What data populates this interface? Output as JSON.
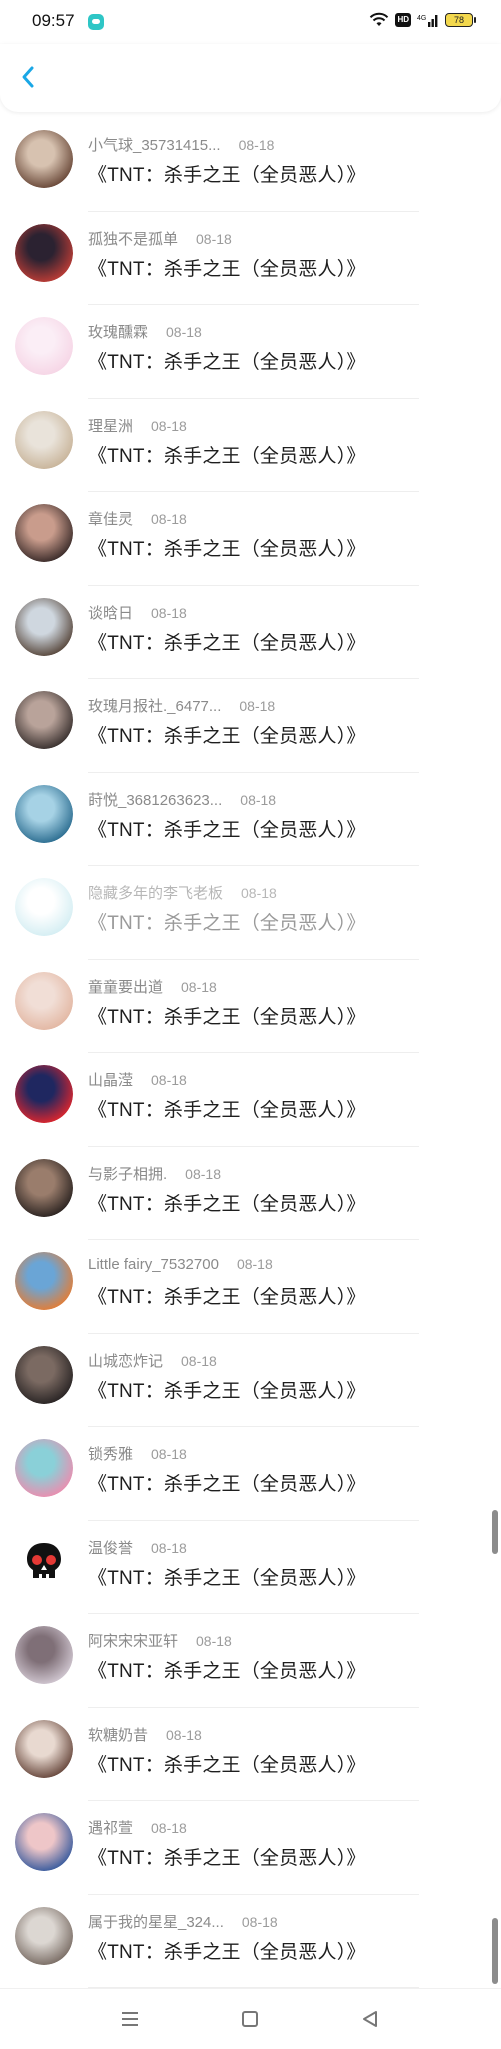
{
  "status_bar": {
    "time": "09:57",
    "app_icon": "message-bubble-icon",
    "hd_label": "HD",
    "signal_label": "4G",
    "battery": "78"
  },
  "header": {
    "back_icon": "chevron-left-icon",
    "accent": "#1aa7e6"
  },
  "message_text": "《TNT：杀手之王（全员恶人）》",
  "items": [
    {
      "name": "小气球_35731415...",
      "date": "08-18",
      "avatar_colors": [
        "#6b4a3a",
        "#d7c2b0"
      ]
    },
    {
      "name": "孤独不是孤单",
      "date": "08-18",
      "avatar_colors": [
        "#b93c36",
        "#2b2231"
      ]
    },
    {
      "name": "玫瑰醺霖",
      "date": "08-18",
      "avatar_colors": [
        "#f6d6e6",
        "#fbeef6"
      ]
    },
    {
      "name": "理星洲",
      "date": "08-18",
      "avatar_colors": [
        "#c9b59b",
        "#e9e3da"
      ]
    },
    {
      "name": "章佳灵",
      "date": "08-18",
      "avatar_colors": [
        "#3d2d2b",
        "#c99c8c"
      ]
    },
    {
      "name": "谈晗日",
      "date": "08-18",
      "avatar_colors": [
        "#5a4a3f",
        "#cfd7df"
      ]
    },
    {
      "name": "玫瑰月报社._6477...",
      "date": "08-18",
      "avatar_colors": [
        "#3b3230",
        "#b9a39a"
      ]
    },
    {
      "name": "莳悦_3681263623...",
      "date": "08-18",
      "avatar_colors": [
        "#2e6f92",
        "#a6d2e5"
      ]
    },
    {
      "name": "隐藏多年的李飞老板",
      "date": "08-18",
      "avatar_colors": [
        "#d5eef3",
        "#ffffff"
      ],
      "faded": true
    },
    {
      "name": "童童要出道",
      "date": "08-18",
      "avatar_colors": [
        "#e3b8a4",
        "#f1ded6"
      ]
    },
    {
      "name": "山晶滢",
      "date": "08-18",
      "avatar_colors": [
        "#d8262f",
        "#1f2760"
      ]
    },
    {
      "name": "与影子相拥.",
      "date": "08-18",
      "avatar_colors": [
        "#2d2522",
        "#9a7d6c"
      ]
    },
    {
      "name": "Little fairy_7532700",
      "date": "08-18",
      "avatar_colors": [
        "#e07e3a",
        "#6aa5d6"
      ]
    },
    {
      "name": "山城恋炸记",
      "date": "08-18",
      "avatar_colors": [
        "#2a2525",
        "#7b6a62"
      ]
    },
    {
      "name": "锁秀雅",
      "date": "08-18",
      "avatar_colors": [
        "#e98fb0",
        "#8ad0d8"
      ]
    },
    {
      "name": "温俊誉",
      "date": "08-18",
      "avatar_colors": [
        "#ffffff",
        "#ffffff"
      ],
      "skull": true
    },
    {
      "name": "阿宋宋宋亚轩",
      "date": "08-18",
      "avatar_colors": [
        "#cfc5cf",
        "#7f6f77"
      ]
    },
    {
      "name": "软糖奶昔",
      "date": "08-18",
      "avatar_colors": [
        "#6a4a3f",
        "#e8d9d0"
      ]
    },
    {
      "name": "遇祁萱",
      "date": "08-18",
      "avatar_colors": [
        "#3d5d9e",
        "#eec6c8"
      ]
    },
    {
      "name": "属于我的星星_324...",
      "date": "08-18",
      "avatar_colors": [
        "#7c6f67",
        "#dcd7d2"
      ]
    }
  ],
  "nav": {
    "menu_icon": "menu-icon",
    "home_icon": "square-home-icon",
    "back_icon": "triangle-back-icon"
  }
}
